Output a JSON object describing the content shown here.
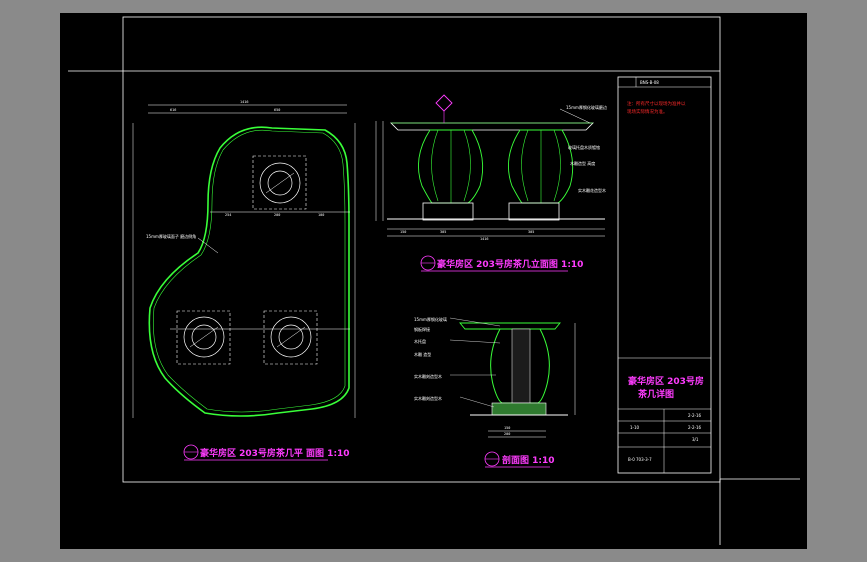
{
  "drawing": {
    "plan_title": "豪华房区 203号房茶几平 面图 1:10",
    "elevation_title": "豪华房区 203号房茶几立面图 1:10",
    "section_title": "剖面图 1:10",
    "title_block": {
      "header": "BNS-B-08",
      "notes": [
        "注：所有尺寸以现场为准并以",
        "  现场实际情况为准。"
      ],
      "drawing_name_line1": "豪华房区 203号房",
      "drawing_name_line2": "茶几详图",
      "scale_label": "1:10",
      "row_values": [
        "2-2-16",
        "1-10",
        "2-2-16",
        "3/1",
        "B-0 703-3-7"
      ]
    },
    "callouts": {
      "plan_note": "15mm厚玻璃面子 磨边倒角",
      "elev_note1": "15mm厚钢化玻璃磨边",
      "elev_note2": "玻璃托盘木质镀铬",
      "elev_note3": "木雕造型 高度",
      "elev_note4": "实木雕花造型木",
      "section_notes": [
        "15mm厚钢化玻璃",
        "钢板焊接",
        "木托盘",
        "木雕 造型",
        "实木雕刻造型木",
        "实木雕刻造型木"
      ]
    }
  }
}
